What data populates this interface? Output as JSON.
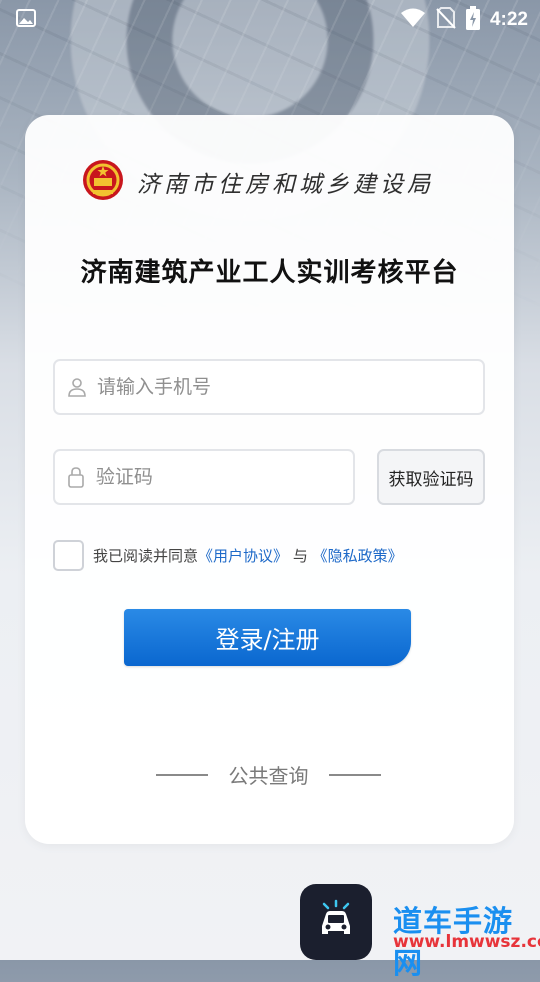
{
  "status_bar": {
    "time": "4:22",
    "icons": [
      "image-icon",
      "wifi-icon",
      "no-sim-icon",
      "battery-charging-icon"
    ]
  },
  "card": {
    "agency_name": "济南市住房和城乡建设局",
    "agency_emblem": "national-emblem-icon",
    "platform_title": "济南建筑产业工人实训考核平台"
  },
  "form": {
    "phone_placeholder": "请输入手机号",
    "code_placeholder": "验证码",
    "get_code_label": "获取验证码",
    "agree_prefix": "我已阅读并同意",
    "user_agreement": "《用户协议》",
    "agree_and": "与",
    "privacy_policy": "《隐私政策》",
    "login_label": "登录/注册"
  },
  "footer": {
    "public_query": "公共查询"
  },
  "watermark": {
    "name": "道车手游网",
    "url": "www.lmwwsz.com"
  },
  "colors": {
    "primary": "#0a67cf",
    "link": "#1d69c8",
    "watermark_name": "#1a8ff0",
    "watermark_url": "#e7343a"
  }
}
